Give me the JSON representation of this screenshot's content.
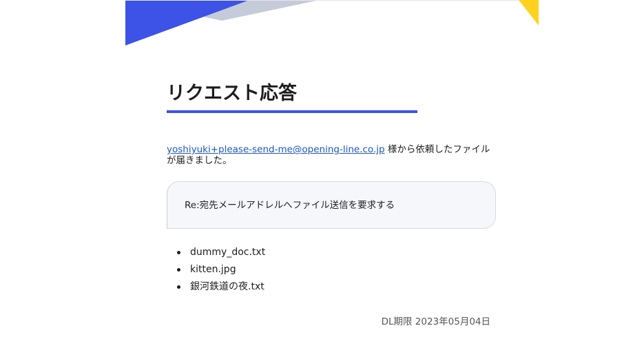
{
  "title": "リクエスト応答",
  "intro": {
    "requester_email": "yoshiyuki+please-send-me@opening-line.co.jp",
    "message": " 様から依頼したファイルが届きました。"
  },
  "subject": "Re:宛先メールアドレルへファイル送信を要求する",
  "files": [
    {
      "name": "dummy_doc.txt"
    },
    {
      "name": "kitten.jpg"
    },
    {
      "name": "銀河鉄道の夜.txt"
    }
  ],
  "deadline": {
    "text": "DL期限 2023年05月04日"
  },
  "colors": {
    "accent_blue": "#3d52e6",
    "accent_yellow": "#ffd21f",
    "accent_gray": "#c5cbd9",
    "link": "#1a56c4"
  }
}
